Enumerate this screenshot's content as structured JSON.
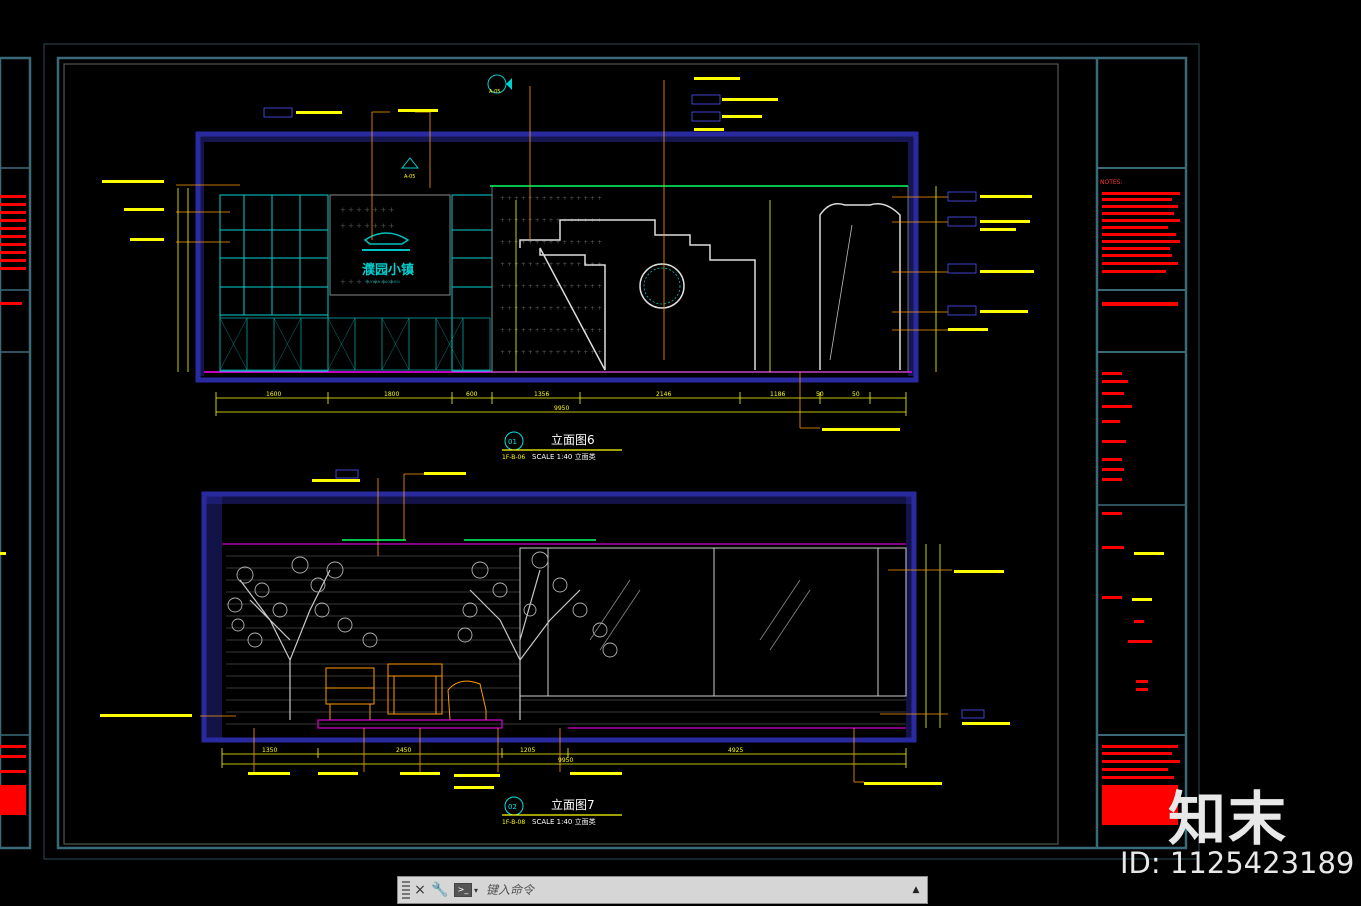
{
  "drawing": {
    "elevation_6": {
      "number": "01",
      "title": "立面图6",
      "ref": "1F-B-06",
      "scale": "SCALE  1:40 立面类",
      "bottom_dims": [
        "1600",
        "1800",
        "600",
        "1356",
        "2146",
        "1186",
        "50",
        "50"
      ],
      "total_dim": "9950",
      "sign_text": "濮园小镇",
      "sign_sub": "PUYUAN XIAOZHEN"
    },
    "elevation_7": {
      "number": "02",
      "title": "立面图7",
      "ref": "1F-B-08",
      "scale": "SCALE  1:40 立面类",
      "bottom_dims": [
        "1350",
        "2450",
        "1205",
        "4925"
      ],
      "total_dim": "9950"
    },
    "section_marks": [
      "A-05",
      "A-05"
    ],
    "notes_label": "NOTES:"
  },
  "command_bar": {
    "placeholder": "键入命令",
    "close_icon": "×",
    "wrench_icon": "🔧",
    "prompt_icon": ">_",
    "scroll_icon": "▲"
  },
  "watermark": {
    "brand": "知末",
    "id": "ID: 1125423189"
  },
  "colors": {
    "frame": "#2a5a6a",
    "wall": "#2a2aa0",
    "cyan": "#00e5e5",
    "yellow": "#ffff00",
    "red": "#ff0000",
    "orange": "#ff9a00",
    "white": "#ffffff",
    "magenta": "#ff00ff",
    "green": "#00ff66",
    "gray": "#b8b8b8"
  }
}
